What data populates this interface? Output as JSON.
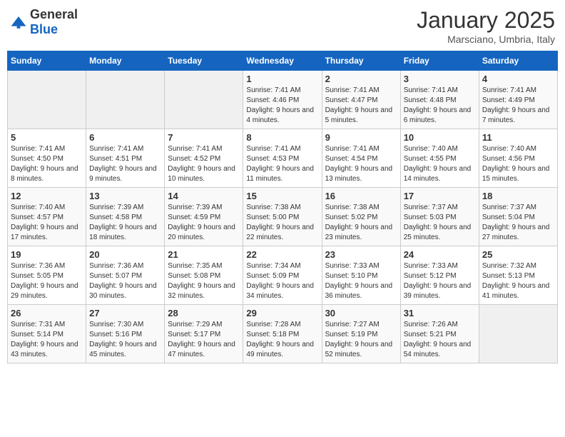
{
  "header": {
    "logo_general": "General",
    "logo_blue": "Blue",
    "month": "January 2025",
    "location": "Marsciano, Umbria, Italy"
  },
  "weekdays": [
    "Sunday",
    "Monday",
    "Tuesday",
    "Wednesday",
    "Thursday",
    "Friday",
    "Saturday"
  ],
  "weeks": [
    [
      {
        "day": "",
        "info": ""
      },
      {
        "day": "",
        "info": ""
      },
      {
        "day": "",
        "info": ""
      },
      {
        "day": "1",
        "info": "Sunrise: 7:41 AM\nSunset: 4:46 PM\nDaylight: 9 hours and 4 minutes."
      },
      {
        "day": "2",
        "info": "Sunrise: 7:41 AM\nSunset: 4:47 PM\nDaylight: 9 hours and 5 minutes."
      },
      {
        "day": "3",
        "info": "Sunrise: 7:41 AM\nSunset: 4:48 PM\nDaylight: 9 hours and 6 minutes."
      },
      {
        "day": "4",
        "info": "Sunrise: 7:41 AM\nSunset: 4:49 PM\nDaylight: 9 hours and 7 minutes."
      }
    ],
    [
      {
        "day": "5",
        "info": "Sunrise: 7:41 AM\nSunset: 4:50 PM\nDaylight: 9 hours and 8 minutes."
      },
      {
        "day": "6",
        "info": "Sunrise: 7:41 AM\nSunset: 4:51 PM\nDaylight: 9 hours and 9 minutes."
      },
      {
        "day": "7",
        "info": "Sunrise: 7:41 AM\nSunset: 4:52 PM\nDaylight: 9 hours and 10 minutes."
      },
      {
        "day": "8",
        "info": "Sunrise: 7:41 AM\nSunset: 4:53 PM\nDaylight: 9 hours and 11 minutes."
      },
      {
        "day": "9",
        "info": "Sunrise: 7:41 AM\nSunset: 4:54 PM\nDaylight: 9 hours and 13 minutes."
      },
      {
        "day": "10",
        "info": "Sunrise: 7:40 AM\nSunset: 4:55 PM\nDaylight: 9 hours and 14 minutes."
      },
      {
        "day": "11",
        "info": "Sunrise: 7:40 AM\nSunset: 4:56 PM\nDaylight: 9 hours and 15 minutes."
      }
    ],
    [
      {
        "day": "12",
        "info": "Sunrise: 7:40 AM\nSunset: 4:57 PM\nDaylight: 9 hours and 17 minutes."
      },
      {
        "day": "13",
        "info": "Sunrise: 7:39 AM\nSunset: 4:58 PM\nDaylight: 9 hours and 18 minutes."
      },
      {
        "day": "14",
        "info": "Sunrise: 7:39 AM\nSunset: 4:59 PM\nDaylight: 9 hours and 20 minutes."
      },
      {
        "day": "15",
        "info": "Sunrise: 7:38 AM\nSunset: 5:00 PM\nDaylight: 9 hours and 22 minutes."
      },
      {
        "day": "16",
        "info": "Sunrise: 7:38 AM\nSunset: 5:02 PM\nDaylight: 9 hours and 23 minutes."
      },
      {
        "day": "17",
        "info": "Sunrise: 7:37 AM\nSunset: 5:03 PM\nDaylight: 9 hours and 25 minutes."
      },
      {
        "day": "18",
        "info": "Sunrise: 7:37 AM\nSunset: 5:04 PM\nDaylight: 9 hours and 27 minutes."
      }
    ],
    [
      {
        "day": "19",
        "info": "Sunrise: 7:36 AM\nSunset: 5:05 PM\nDaylight: 9 hours and 29 minutes."
      },
      {
        "day": "20",
        "info": "Sunrise: 7:36 AM\nSunset: 5:07 PM\nDaylight: 9 hours and 30 minutes."
      },
      {
        "day": "21",
        "info": "Sunrise: 7:35 AM\nSunset: 5:08 PM\nDaylight: 9 hours and 32 minutes."
      },
      {
        "day": "22",
        "info": "Sunrise: 7:34 AM\nSunset: 5:09 PM\nDaylight: 9 hours and 34 minutes."
      },
      {
        "day": "23",
        "info": "Sunrise: 7:33 AM\nSunset: 5:10 PM\nDaylight: 9 hours and 36 minutes."
      },
      {
        "day": "24",
        "info": "Sunrise: 7:33 AM\nSunset: 5:12 PM\nDaylight: 9 hours and 39 minutes."
      },
      {
        "day": "25",
        "info": "Sunrise: 7:32 AM\nSunset: 5:13 PM\nDaylight: 9 hours and 41 minutes."
      }
    ],
    [
      {
        "day": "26",
        "info": "Sunrise: 7:31 AM\nSunset: 5:14 PM\nDaylight: 9 hours and 43 minutes."
      },
      {
        "day": "27",
        "info": "Sunrise: 7:30 AM\nSunset: 5:16 PM\nDaylight: 9 hours and 45 minutes."
      },
      {
        "day": "28",
        "info": "Sunrise: 7:29 AM\nSunset: 5:17 PM\nDaylight: 9 hours and 47 minutes."
      },
      {
        "day": "29",
        "info": "Sunrise: 7:28 AM\nSunset: 5:18 PM\nDaylight: 9 hours and 49 minutes."
      },
      {
        "day": "30",
        "info": "Sunrise: 7:27 AM\nSunset: 5:19 PM\nDaylight: 9 hours and 52 minutes."
      },
      {
        "day": "31",
        "info": "Sunrise: 7:26 AM\nSunset: 5:21 PM\nDaylight: 9 hours and 54 minutes."
      },
      {
        "day": "",
        "info": ""
      }
    ]
  ]
}
